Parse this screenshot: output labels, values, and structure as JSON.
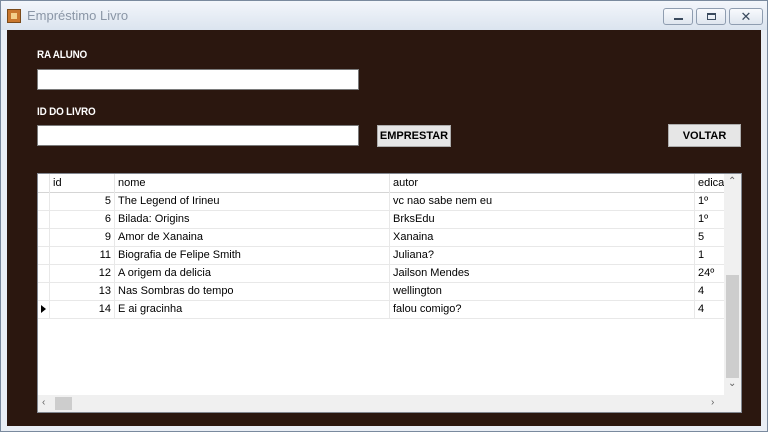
{
  "window": {
    "title": "Empréstimo Livro"
  },
  "form": {
    "ra_label": "RA ALUNO",
    "ra_value": "",
    "id_label": "ID DO LIVRO",
    "id_value": "",
    "emprestar_label": "EMPRESTAR",
    "voltar_label": "VOLTAR"
  },
  "grid": {
    "columns": [
      "id",
      "nome",
      "autor",
      "edicao"
    ],
    "rows": [
      {
        "id": "5",
        "nome": "The Legend of Irineu",
        "autor": "vc nao sabe nem eu",
        "edicao": "1º"
      },
      {
        "id": "6",
        "nome": "Bilada: Origins",
        "autor": "BrksEdu",
        "edicao": "1º"
      },
      {
        "id": "9",
        "nome": "Amor de Xanaina",
        "autor": "Xanaina",
        "edicao": "5"
      },
      {
        "id": "11",
        "nome": "Biografia de Felipe Smith",
        "autor": "Juliana?",
        "edicao": "1"
      },
      {
        "id": "12",
        "nome": "A origem da delicia",
        "autor": "Jailson Mendes",
        "edicao": "24º"
      },
      {
        "id": "13",
        "nome": "Nas Sombras do tempo",
        "autor": "wellington",
        "edicao": "4"
      },
      {
        "id": "14",
        "nome": "E ai gracinha",
        "autor": "falou comigo?",
        "edicao": "4"
      }
    ],
    "current_row_index": 6
  },
  "colors": {
    "content_bg": "#2b170f",
    "label_text": "#ffffff"
  },
  "icons": {
    "minimize": "minimize-icon",
    "maximize": "maximize-icon",
    "close": "close-icon",
    "row_pointer": "row-pointer-icon"
  }
}
